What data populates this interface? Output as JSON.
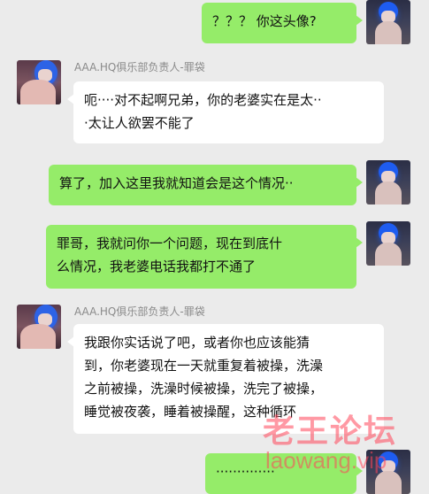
{
  "chat": {
    "sender_name": "AAA.HQ俱乐部负责人-罪袋",
    "messages": [
      {
        "side": "right",
        "text": "？？？ 你这头像?"
      },
      {
        "side": "left",
        "lines": [
          "呃····对不起啊兄弟，你的老婆实在是太··",
          "·太让人欲罢不能了"
        ]
      },
      {
        "side": "right",
        "text": "算了，加入这里我就知道会是这个情况··"
      },
      {
        "side": "right",
        "lines": [
          "罪哥，我就问你一个问题，现在到底什",
          "么情况，我老婆电话我都打不通了"
        ]
      },
      {
        "side": "left",
        "lines": [
          "我跟你实话说了吧，或者你也应该能猜",
          "到，你老婆现在一天就重复着被操，洗澡",
          "之前被操，洗澡时候被操，洗完了被操，",
          "睡觉被夜袭，睡着被操醒，这种循环"
        ]
      },
      {
        "side": "right",
        "text": "··············"
      }
    ]
  },
  "watermark": {
    "cn": "老王论坛",
    "en": "laowang.vip"
  },
  "colors": {
    "background": "#ebebeb",
    "bubble_self": "#95ec69",
    "bubble_other": "#ffffff"
  }
}
